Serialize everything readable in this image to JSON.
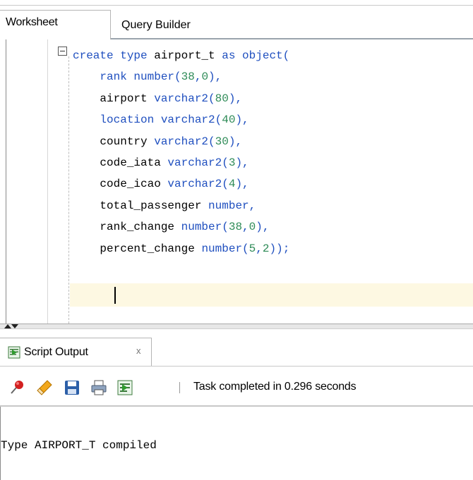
{
  "tabs": {
    "worksheet": "Worksheet",
    "query_builder": "Query Builder"
  },
  "editor": {
    "lines": [
      [
        {
          "t": "create type ",
          "c": "kw"
        },
        {
          "t": "airport_t",
          "c": ""
        },
        {
          "t": " as object(",
          "c": "kw"
        }
      ],
      [
        {
          "t": "    rank number(",
          "c": "kw"
        },
        {
          "t": "38",
          "c": "num"
        },
        {
          "t": ",",
          "c": "kw"
        },
        {
          "t": "0",
          "c": "num"
        },
        {
          "t": "),",
          "c": "kw"
        }
      ],
      [
        {
          "t": "    airport ",
          "c": ""
        },
        {
          "t": "varchar2(",
          "c": "kw"
        },
        {
          "t": "80",
          "c": "num"
        },
        {
          "t": "),",
          "c": "kw"
        }
      ],
      [
        {
          "t": "    location varchar2(",
          "c": "kw"
        },
        {
          "t": "40",
          "c": "num"
        },
        {
          "t": "),",
          "c": "kw"
        }
      ],
      [
        {
          "t": "    country ",
          "c": ""
        },
        {
          "t": "varchar2(",
          "c": "kw"
        },
        {
          "t": "30",
          "c": "num"
        },
        {
          "t": "),",
          "c": "kw"
        }
      ],
      [
        {
          "t": "    code_iata ",
          "c": ""
        },
        {
          "t": "varchar2(",
          "c": "kw"
        },
        {
          "t": "3",
          "c": "num"
        },
        {
          "t": "),",
          "c": "kw"
        }
      ],
      [
        {
          "t": "    code_icao ",
          "c": ""
        },
        {
          "t": "varchar2(",
          "c": "kw"
        },
        {
          "t": "4",
          "c": "num"
        },
        {
          "t": "),",
          "c": "kw"
        }
      ],
      [
        {
          "t": "    total_passenger ",
          "c": ""
        },
        {
          "t": "number,",
          "c": "kw"
        }
      ],
      [
        {
          "t": "    rank_change ",
          "c": ""
        },
        {
          "t": "number(",
          "c": "kw"
        },
        {
          "t": "38",
          "c": "num"
        },
        {
          "t": ",",
          "c": "kw"
        },
        {
          "t": "0",
          "c": "num"
        },
        {
          "t": "),",
          "c": "kw"
        }
      ],
      [
        {
          "t": "    percent_change ",
          "c": ""
        },
        {
          "t": "number(",
          "c": "kw"
        },
        {
          "t": "5",
          "c": "num"
        },
        {
          "t": ",",
          "c": "kw"
        },
        {
          "t": "2",
          "c": "num"
        },
        {
          "t": "));",
          "c": "kw"
        }
      ]
    ]
  },
  "output_tab": {
    "label": "Script Output",
    "close": "x"
  },
  "toolbar": {
    "icons": [
      "pin-icon",
      "eraser-icon",
      "save-icon",
      "print-icon",
      "script-icon"
    ],
    "status": "Task completed in 0.296 seconds"
  },
  "output": {
    "text": "Type AIRPORT_T compiled"
  },
  "colors": {
    "keyword": "#1f4fbf",
    "number": "#2e8b57",
    "current_line": "#fdf8e2"
  }
}
